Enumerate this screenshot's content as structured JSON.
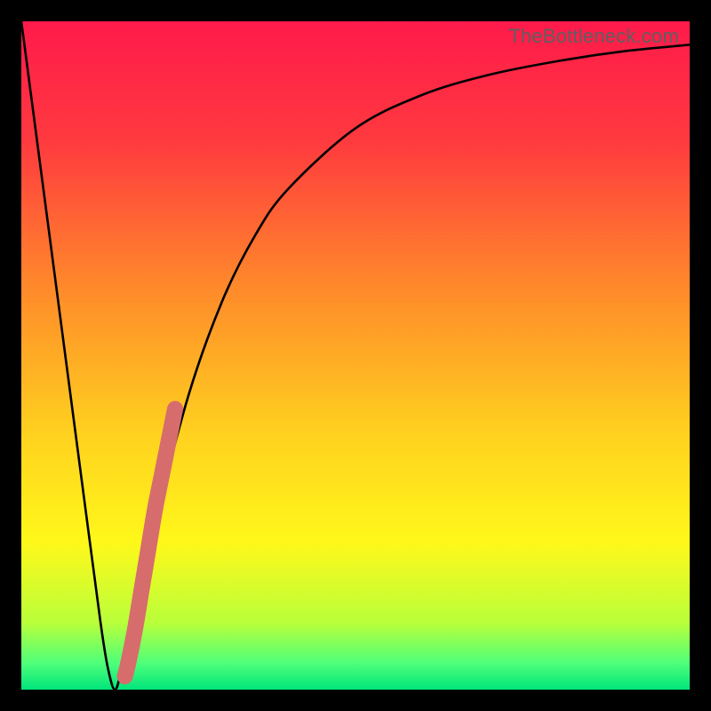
{
  "attribution": "TheBottleneck.com",
  "colors": {
    "frame": "#000000",
    "curve": "#000000",
    "highlight": "#d76c6c",
    "gradient_stops": [
      {
        "pct": 0,
        "color": "#ff1a4b"
      },
      {
        "pct": 18,
        "color": "#ff3a3f"
      },
      {
        "pct": 40,
        "color": "#ff8a2a"
      },
      {
        "pct": 62,
        "color": "#ffd21f"
      },
      {
        "pct": 78,
        "color": "#fff81a"
      },
      {
        "pct": 90,
        "color": "#b9ff3a"
      },
      {
        "pct": 96,
        "color": "#4fff7a"
      },
      {
        "pct": 100,
        "color": "#00e57b"
      }
    ]
  },
  "chart_data": {
    "type": "line",
    "title": "",
    "xlabel": "",
    "ylabel": "",
    "xlim": [
      0,
      100
    ],
    "ylim": [
      0,
      100
    ],
    "grid": false,
    "series": [
      {
        "name": "bottleneck-curve",
        "x": [
          0,
          5,
          10,
          12,
          13,
          14,
          15,
          17,
          20,
          25,
          30,
          35,
          40,
          50,
          60,
          70,
          80,
          90,
          100
        ],
        "values": [
          100,
          62,
          24,
          9,
          3,
          0,
          3,
          12,
          25,
          44,
          58,
          68,
          75,
          84,
          89,
          92,
          94,
          95.5,
          96.5
        ]
      }
    ],
    "annotations": [
      {
        "name": "highlight-segment",
        "x": [
          15.5,
          16,
          17,
          18,
          19,
          20,
          21,
          22,
          23
        ],
        "values": [
          2,
          4,
          9,
          15,
          21,
          27,
          32,
          37,
          42
        ]
      }
    ]
  }
}
